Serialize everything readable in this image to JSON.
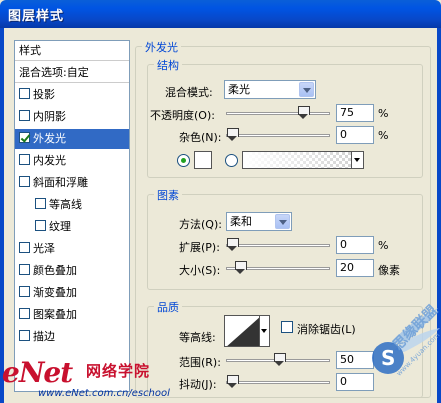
{
  "window": {
    "title": "图层样式"
  },
  "styles_list": {
    "header": "样式",
    "blend_options": "混合选项:自定",
    "items": [
      {
        "label": "投影",
        "checked": false,
        "selected": false,
        "sub": false
      },
      {
        "label": "内阴影",
        "checked": false,
        "selected": false,
        "sub": false
      },
      {
        "label": "外发光",
        "checked": true,
        "selected": true,
        "sub": false
      },
      {
        "label": "内发光",
        "checked": false,
        "selected": false,
        "sub": false
      },
      {
        "label": "斜面和浮雕",
        "checked": false,
        "selected": false,
        "sub": false
      },
      {
        "label": "等高线",
        "checked": false,
        "selected": false,
        "sub": true
      },
      {
        "label": "纹理",
        "checked": false,
        "selected": false,
        "sub": true
      },
      {
        "label": "光泽",
        "checked": false,
        "selected": false,
        "sub": false
      },
      {
        "label": "颜色叠加",
        "checked": false,
        "selected": false,
        "sub": false
      },
      {
        "label": "渐变叠加",
        "checked": false,
        "selected": false,
        "sub": false
      },
      {
        "label": "图案叠加",
        "checked": false,
        "selected": false,
        "sub": false
      },
      {
        "label": "描边",
        "checked": false,
        "selected": false,
        "sub": false
      }
    ]
  },
  "outer_glow": {
    "title": "外发光",
    "structure": {
      "title": "结构",
      "blend_mode_label": "混合模式:",
      "blend_mode_value": "柔光",
      "opacity_label": "不透明度(O):",
      "opacity_value": "75",
      "opacity_unit": "%",
      "opacity_fraction": 0.75,
      "noise_label": "杂色(N):",
      "noise_value": "0",
      "noise_unit": "%",
      "noise_fraction": 0.0,
      "color_mode": "solid",
      "swatch_color": "#ffffff"
    },
    "elements": {
      "title": "图素",
      "technique_label": "方法(Q):",
      "technique_value": "柔和",
      "spread_label": "扩展(P):",
      "spread_value": "0",
      "spread_unit": "%",
      "spread_fraction": 0.0,
      "size_label": "大小(S):",
      "size_value": "20",
      "size_unit": "像素",
      "size_fraction": 0.08
    },
    "quality": {
      "title": "品质",
      "contour_label": "等高线:",
      "anti_alias_label": "消除锯齿(L)",
      "anti_alias_checked": false,
      "range_label": "范围(R):",
      "range_value": "50",
      "range_fraction": 0.5,
      "jitter_label": "抖动(J):",
      "jitter_value": "0",
      "jitter_fraction": 0.0
    }
  },
  "watermark": {
    "brand": "eNet",
    "brand_cn": "网络学院",
    "url": "www.eNet.com.cn/eschool",
    "logo_cn": "思缘联盟",
    "logo_url": "www.4yuan.com"
  },
  "colors": {
    "title_bar": "#0054e3",
    "selection": "#316ac5",
    "group_title": "#0046d5",
    "watermark_red": "#c8102e"
  }
}
